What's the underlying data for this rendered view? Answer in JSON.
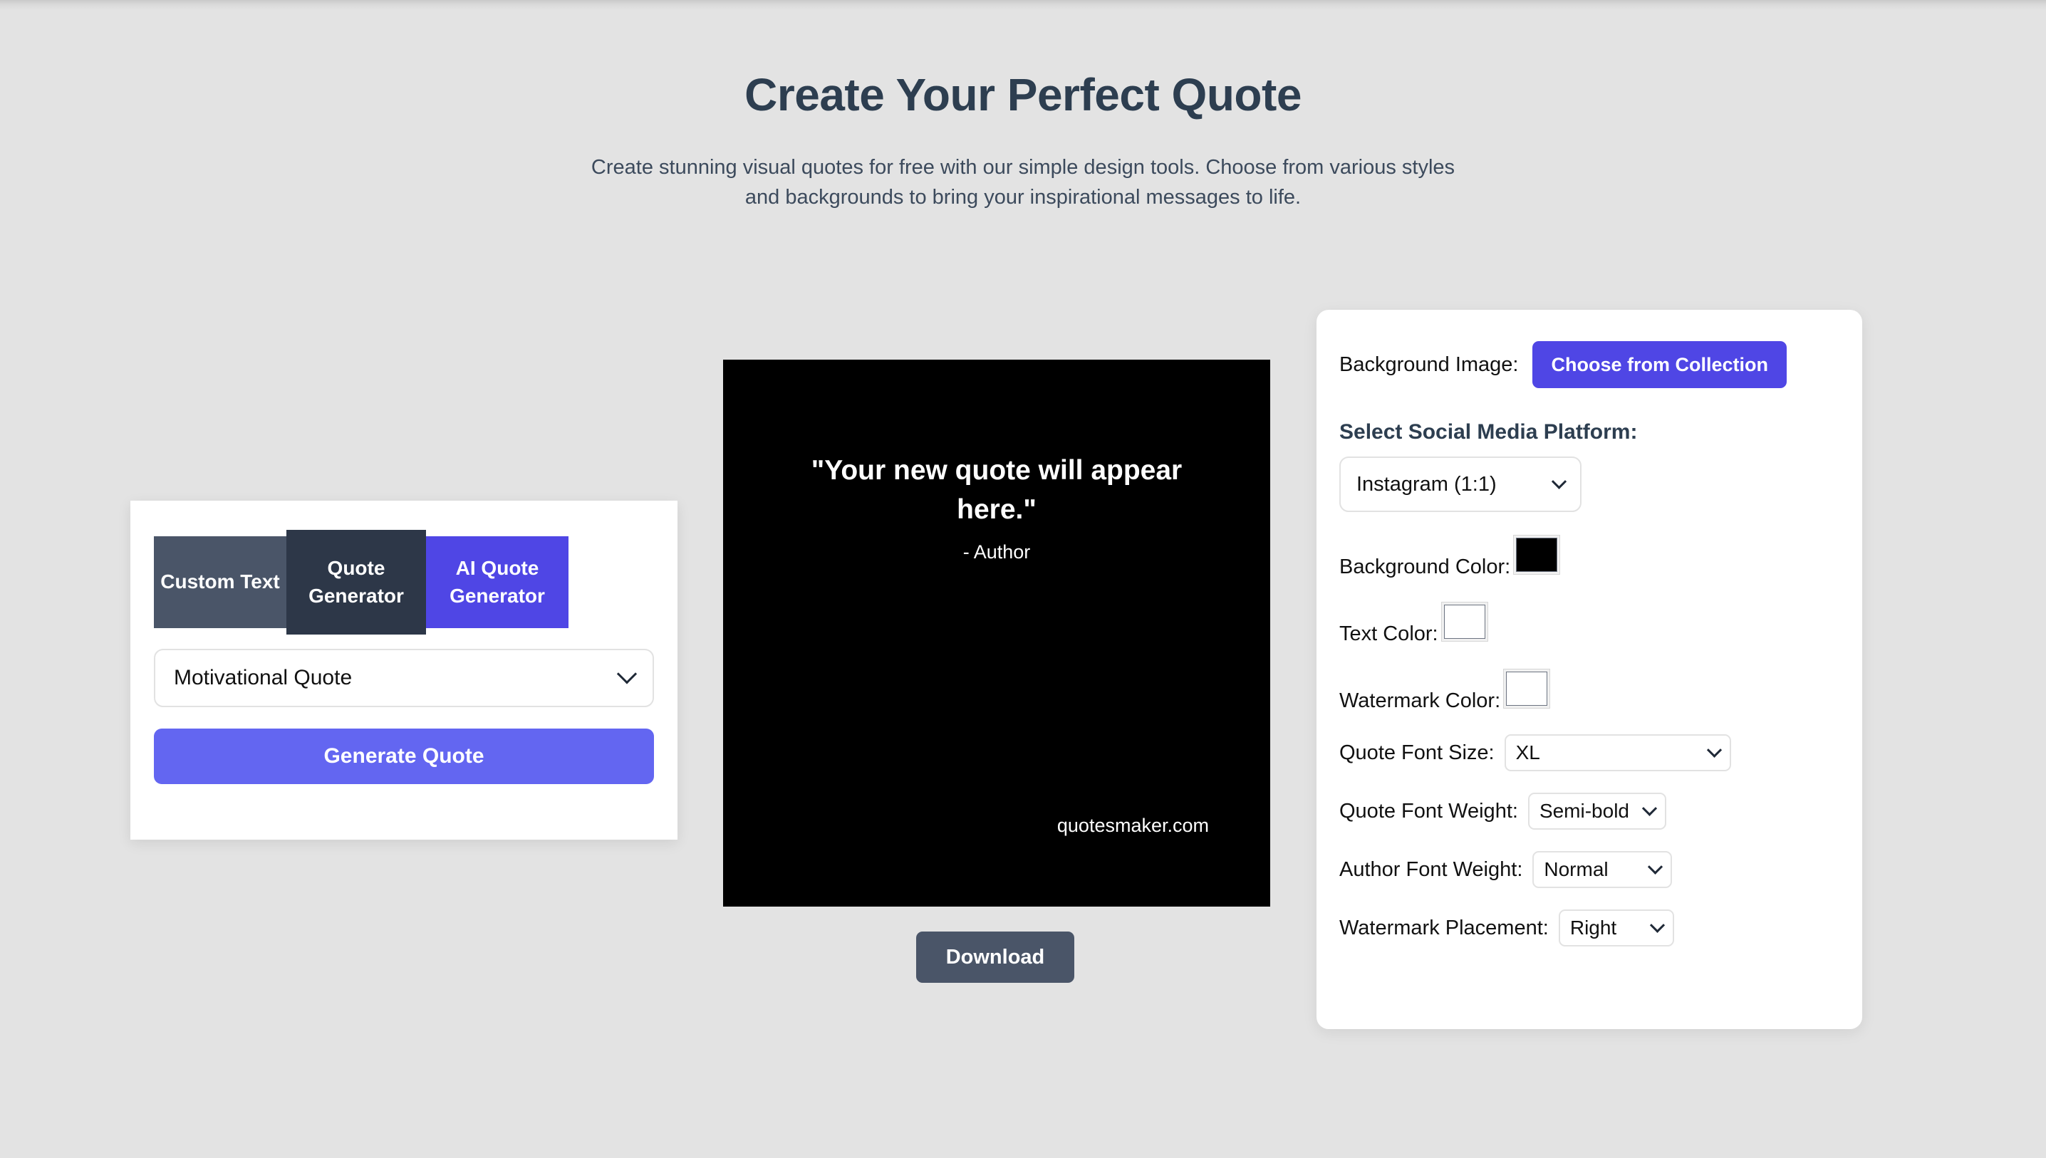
{
  "header": {
    "title": "Create Your Perfect Quote",
    "subtitle": "Create stunning visual quotes for free with our simple design tools. Choose from various styles and backgrounds to bring your inspirational messages to life."
  },
  "generator_panel": {
    "tabs": [
      {
        "label": "Custom Text",
        "active": false
      },
      {
        "label": "Quote Generator",
        "active": true
      },
      {
        "label": "AI Quote Generator",
        "active": false
      }
    ],
    "genre_select": {
      "value": "Motivational Quote",
      "icon": "chevron-down-icon"
    },
    "generate_button": "Generate Quote"
  },
  "preview": {
    "quote_text": "\"Your new quote will appear here.\"",
    "author": "- Author",
    "watermark": "quotesmaker.com",
    "background_color": "#000000",
    "text_color": "#ffffff",
    "download_button": "Download"
  },
  "settings": {
    "background_image": {
      "label": "Background Image:",
      "button": "Choose from Collection"
    },
    "platform": {
      "label": "Select Social Media Platform:",
      "value": "Instagram (1:1)",
      "icon": "chevron-down-icon"
    },
    "background_color": {
      "label": "Background Color:",
      "value": "#000000"
    },
    "text_color": {
      "label": "Text Color:",
      "value": "#ffffff"
    },
    "watermark_color": {
      "label": "Watermark Color:",
      "value": "#ffffff"
    },
    "quote_font_size": {
      "label": "Quote Font Size:",
      "value": "XL",
      "icon": "chevron-down-icon"
    },
    "quote_font_weight": {
      "label": "Quote Font Weight:",
      "value": "Semi-bold",
      "icon": "chevron-down-icon"
    },
    "author_font_weight": {
      "label": "Author Font Weight:",
      "value": "Normal",
      "icon": "chevron-down-icon"
    },
    "watermark_placement": {
      "label": "Watermark Placement:",
      "value": "Right",
      "icon": "chevron-down-icon"
    }
  },
  "theme": {
    "page_background": "#e3e3e3",
    "accent_purple": "#4f46e5",
    "button_purple": "#6366f1",
    "slate": "#4a5568",
    "slate_dark": "#2d3748",
    "heading": "#2d3e50"
  }
}
